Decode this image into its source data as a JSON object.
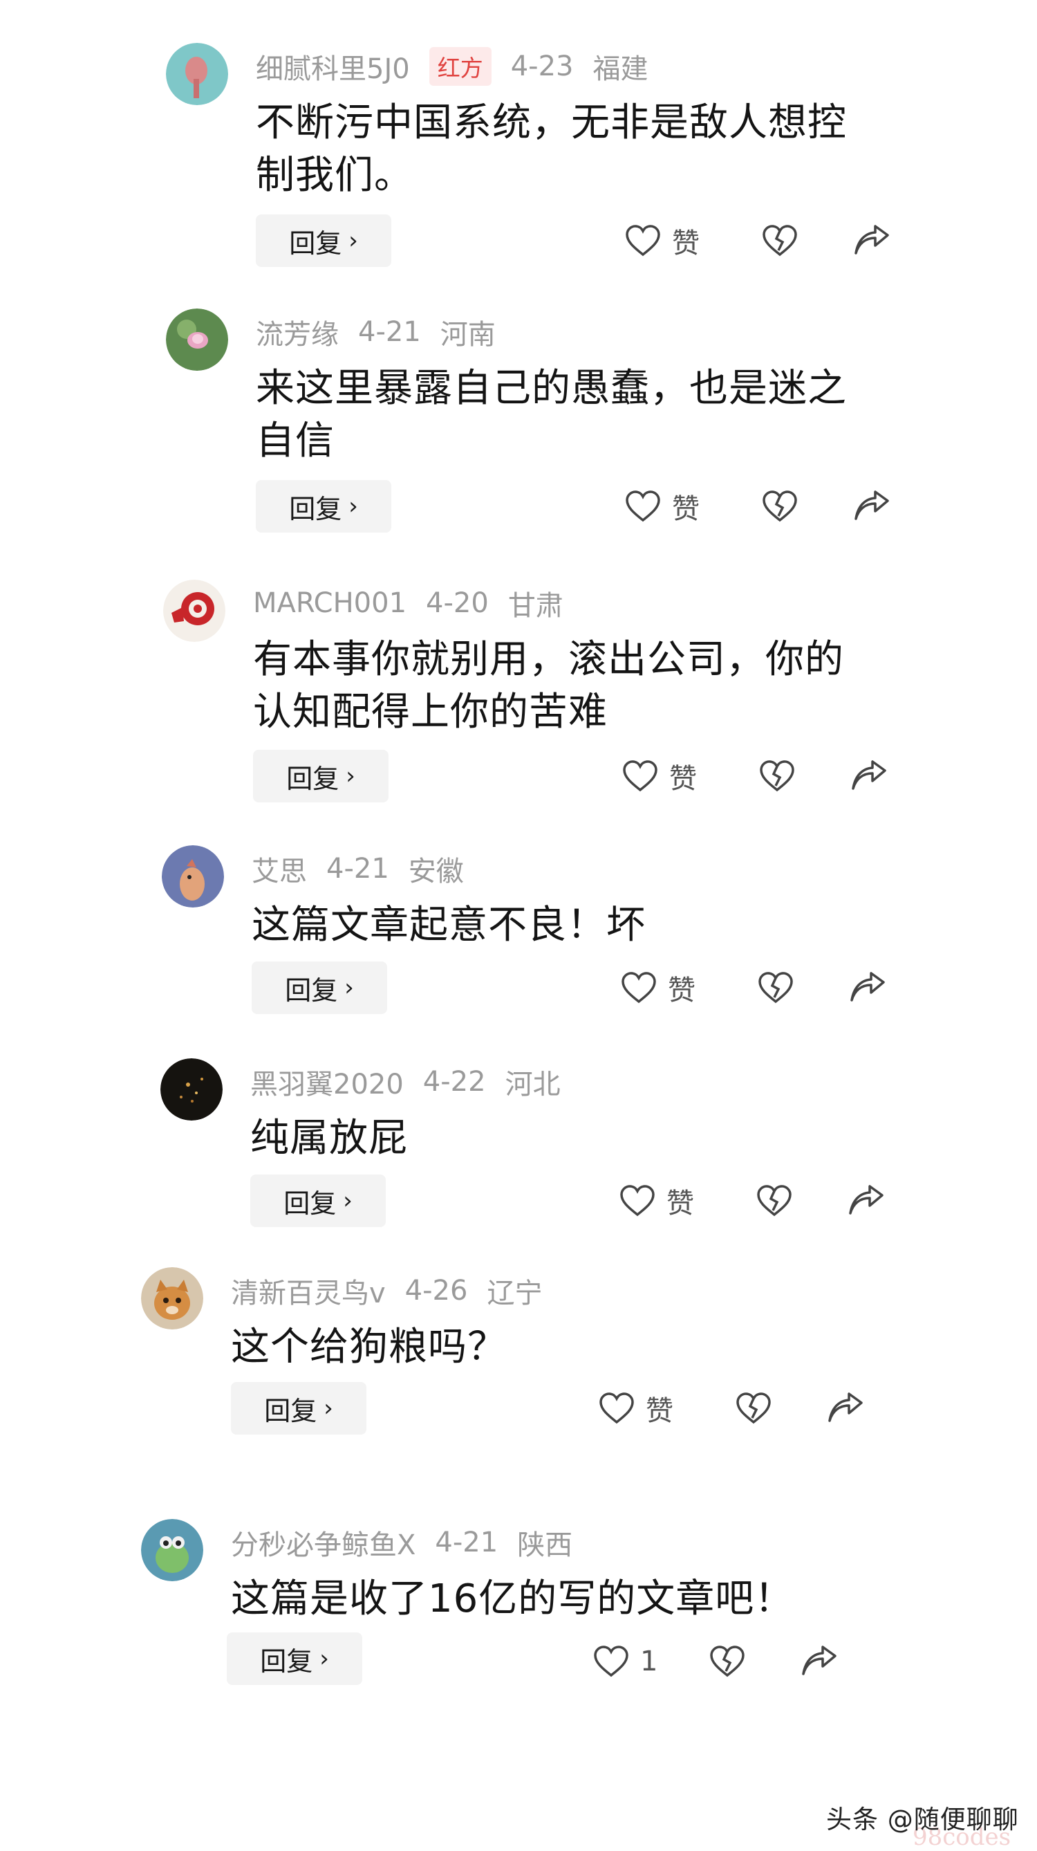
{
  "comments": [
    {
      "username": "细腻科里5J0",
      "badge": "红方",
      "date": "4-23",
      "region": "福建",
      "text": "不断污中国系统，无非是敌人想控制我们。",
      "reply_label": "回复",
      "like_label": "赞"
    },
    {
      "username": "流芳缘",
      "badge": "",
      "date": "4-21",
      "region": "河南",
      "text": "来这里暴露自己的愚蠢，也是迷之自信",
      "reply_label": "回复",
      "like_label": "赞"
    },
    {
      "username": "MARCH001",
      "badge": "",
      "date": "4-20",
      "region": "甘肃",
      "text": "有本事你就别用，滚出公司，你的认知配得上你的苦难",
      "reply_label": "回复",
      "like_label": "赞"
    },
    {
      "username": "艾思",
      "badge": "",
      "date": "4-21",
      "region": "安徽",
      "text": "这篇文章起意不良！坏",
      "reply_label": "回复",
      "like_label": "赞"
    },
    {
      "username": "黑羽翼2020",
      "badge": "",
      "date": "4-22",
      "region": "河北",
      "text": "纯属放屁",
      "reply_label": "回复",
      "like_label": "赞"
    },
    {
      "username": "清新百灵鸟v",
      "badge": "",
      "date": "4-26",
      "region": "辽宁",
      "text": "这个给狗粮吗？",
      "reply_label": "回复",
      "like_label": "赞"
    },
    {
      "username": "分秒必争鲸鱼X",
      "badge": "",
      "date": "4-21",
      "region": "陕西",
      "text": "这篇是收了16亿的写的文章吧！",
      "reply_label": "回复",
      "like_label": "1"
    }
  ],
  "icons": {
    "like": "heart-outline-icon",
    "dislike": "broken-heart-icon",
    "share": "share-arrow-icon",
    "reply_chevron": "chevron-right-icon"
  },
  "watermark": {
    "text": "头条 @随便聊聊",
    "faint": "98codes"
  }
}
